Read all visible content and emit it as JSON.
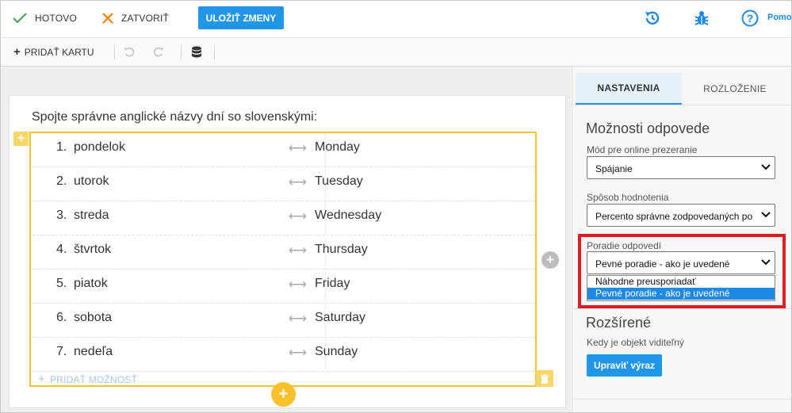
{
  "topbar": {
    "done_label": "HOTOVO",
    "close_label": "ZATVORIŤ",
    "save_label": "ULOŽIŤ ZMENY",
    "help_label": "Pomo"
  },
  "toolbar": {
    "add_card_label": "PRIDAŤ KARTU"
  },
  "question": {
    "text": "Spojte správne anglické názvy dní so slovenskými:",
    "pairs": [
      {
        "num": "1.",
        "left": "pondelok",
        "right": "Monday"
      },
      {
        "num": "2.",
        "left": "utorok",
        "right": "Tuesday"
      },
      {
        "num": "3.",
        "left": "streda",
        "right": "Wednesday"
      },
      {
        "num": "4.",
        "left": "štvrtok",
        "right": "Thursday"
      },
      {
        "num": "5.",
        "left": "piatok",
        "right": "Friday"
      },
      {
        "num": "6.",
        "left": "sobota",
        "right": "Saturday"
      },
      {
        "num": "7.",
        "left": "nedeľa",
        "right": "Sunday"
      }
    ],
    "arrow": "⟷",
    "add_option_label": "PRIDAŤ MOŽNOSŤ"
  },
  "panel": {
    "tabs": [
      {
        "label": "NASTAVENIA",
        "active": true
      },
      {
        "label": "ROZLOŽENIE",
        "active": false
      }
    ],
    "answer_options_title": "Možnosti odpovede",
    "online_mode_label": "Mód pre online prezeranie",
    "online_mode_value": "Spájanie",
    "grading_label": "Spôsob hodnotenia",
    "grading_value": "Percento správne zodpovedaných po",
    "order_label": "Poradie odpovedí",
    "order_value": "Pevné poradie - ako je uvedené",
    "order_options": [
      "Náhodne preusporiadať",
      "Pevné poradie - ako je uvedené"
    ],
    "advanced_title": "Rozšírené",
    "visibility_label": "Kedy je objekt viditeľný",
    "edit_expression_label": "Upraviť výraz"
  },
  "colors": {
    "accent": "#2196e8",
    "highlight": "#e01b24",
    "match_border": "#f6c22c"
  }
}
